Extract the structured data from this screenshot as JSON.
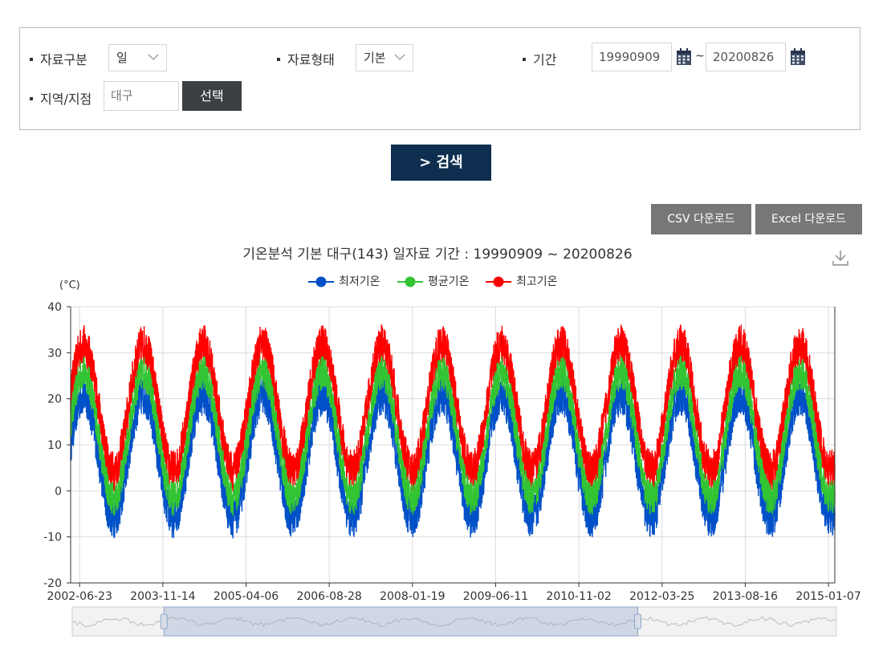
{
  "form": {
    "data_type_label": "자료구분",
    "data_type_value": "일",
    "data_form_label": "자료형태",
    "data_form_value": "기본",
    "period_label": "기간",
    "start_date": "19990909",
    "tilde": "~",
    "end_date": "20200826",
    "region_label": "지역/지점",
    "region_placeholder": "대구",
    "select_button": "선택",
    "search_button": "> 검색"
  },
  "downloads": {
    "csv_label": "CSV 다운로드",
    "excel_label": "Excel 다운로드"
  },
  "colors": {
    "min": "#0050c8",
    "avg": "#33c433",
    "max": "#ff0000",
    "search_button_bg": "#0d2e4f"
  },
  "chart_data": {
    "type": "line",
    "title": "기온분석 기본 대구(143) 일자료 기간 : 19990909 ~ 20200826",
    "unit_label": "(°C)",
    "ylim": [
      -20,
      40
    ],
    "yticks": [
      40,
      30,
      20,
      10,
      0,
      -10,
      -20
    ],
    "x_tick_labels": [
      "2002-06-23",
      "2003-11-14",
      "2005-04-06",
      "2006-08-28",
      "2008-01-19",
      "2009-06-11",
      "2010-11-02",
      "2012-03-25",
      "2013-08-16",
      "2015-01-07"
    ],
    "x_range": [
      "2002-04-29",
      "2015-02-15"
    ],
    "grid": true,
    "legend_position": "top-center",
    "series": [
      {
        "name": "최저기온",
        "color": "#0050c8",
        "summer_peak": 26,
        "winter_low": -11
      },
      {
        "name": "평균기온",
        "color": "#33c433",
        "summer_peak": 31,
        "winter_low": -7
      },
      {
        "name": "최고기온",
        "color": "#ff0000",
        "summer_peak": 37,
        "winter_low": -1
      }
    ],
    "zoom_slider": {
      "window_start_fraction": 0.12,
      "window_end_fraction": 0.74
    }
  }
}
